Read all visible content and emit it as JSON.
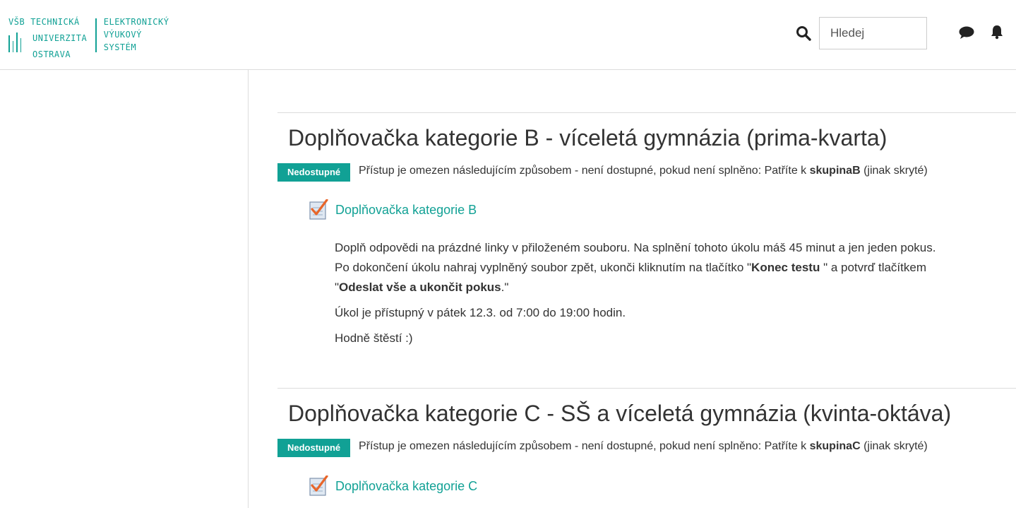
{
  "header": {
    "logo": {
      "line1a": "VŠB",
      "line1b": "TECHNICKÁ",
      "line2": "UNIVERZITA",
      "line3": "OSTRAVA",
      "sys1": "ELEKTRONICKÝ",
      "sys2": "VÝUKOVÝ",
      "sys3": "SYSTÉM"
    },
    "search_placeholder": "Hledej"
  },
  "sections": [
    {
      "title": "Doplňovačka kategorie B - víceletá gymnázia (prima-kvarta)",
      "badge": "Nedostupné",
      "restriction_prefix": "Přístup je omezen následujícím způsobem - není dostupné, pokud není splněno: Patříte k ",
      "restriction_group": "skupinaB",
      "restriction_suffix": " (jinak skryté)",
      "activity": "Doplňovačka kategorie B",
      "description": {
        "p1_line1": "Doplň odpovědi na prázdné linky v přiloženém souboru. Na splnění tohoto úkolu máš 45 minut a jen jeden pokus.",
        "p1_line2_start": "Po dokončení  úkolu nahraj vyplněný soubor zpět, ukonči kliknutím na tlačítko \"",
        "p1_bold1": "Konec testu",
        "p1_line2_end": " \" a potvrď tlačítkem",
        "p1_line3_start": "\"",
        "p1_bold2": "Odeslat vše a ukončit pokus",
        "p1_line3_end": ".\"",
        "p2": "Úkol je přístupný v pátek 12.3. od 7:00 do 19:00 hodin.",
        "p3": "Hodně štěstí :)"
      }
    },
    {
      "title": "Doplňovačka kategorie C - SŠ a víceletá gymnázia (kvinta-oktáva)",
      "badge": "Nedostupné",
      "restriction_prefix": "Přístup je omezen následujícím způsobem - není dostupné, pokud není splněno: Patříte k ",
      "restriction_group": "skupinaC",
      "restriction_suffix": " (jinak skryté)",
      "activity": "Doplňovačka kategorie C"
    }
  ],
  "colors": {
    "accent": "#11a195",
    "text": "#333333",
    "divider": "#dcdcdc"
  }
}
